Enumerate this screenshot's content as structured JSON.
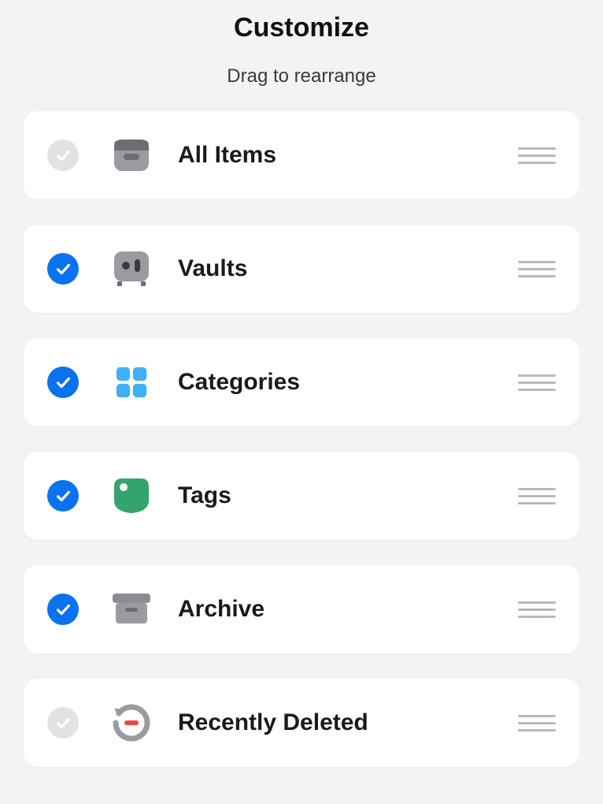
{
  "title": "Customize",
  "subtitle": "Drag to rearrange",
  "colors": {
    "accent": "#0a72ee",
    "checkOff": "#e2e2e4",
    "tag": "#33a46f",
    "categories": "#3fb0f7"
  },
  "items": [
    {
      "label": "All Items",
      "checked": false,
      "icon": "all-items"
    },
    {
      "label": "Vaults",
      "checked": true,
      "icon": "vaults"
    },
    {
      "label": "Categories",
      "checked": true,
      "icon": "categories"
    },
    {
      "label": "Tags",
      "checked": true,
      "icon": "tags"
    },
    {
      "label": "Archive",
      "checked": true,
      "icon": "archive"
    },
    {
      "label": "Recently Deleted",
      "checked": false,
      "icon": "recently-deleted"
    }
  ]
}
